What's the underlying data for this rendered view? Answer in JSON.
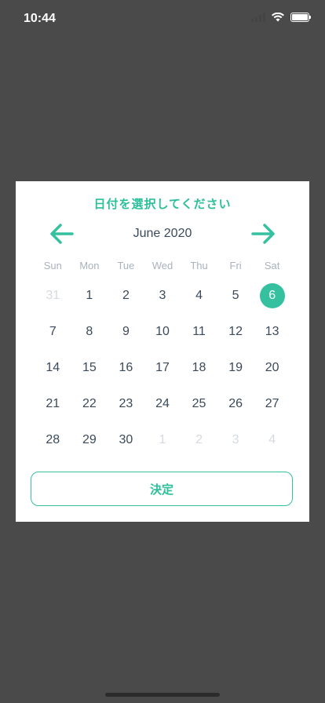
{
  "status_bar": {
    "time": "10:44"
  },
  "dialog": {
    "title": "日付を選択してください",
    "month_label": "June 2020",
    "weekdays": [
      "Sun",
      "Mon",
      "Tue",
      "Wed",
      "Thu",
      "Fri",
      "Sat"
    ],
    "days": [
      {
        "label": "31",
        "muted": true
      },
      {
        "label": "1"
      },
      {
        "label": "2"
      },
      {
        "label": "3"
      },
      {
        "label": "4"
      },
      {
        "label": "5"
      },
      {
        "label": "6",
        "selected": true
      },
      {
        "label": "7"
      },
      {
        "label": "8"
      },
      {
        "label": "9"
      },
      {
        "label": "10"
      },
      {
        "label": "11"
      },
      {
        "label": "12"
      },
      {
        "label": "13"
      },
      {
        "label": "14"
      },
      {
        "label": "15"
      },
      {
        "label": "16"
      },
      {
        "label": "17"
      },
      {
        "label": "18"
      },
      {
        "label": "19"
      },
      {
        "label": "20"
      },
      {
        "label": "21"
      },
      {
        "label": "22"
      },
      {
        "label": "23"
      },
      {
        "label": "24"
      },
      {
        "label": "25"
      },
      {
        "label": "26"
      },
      {
        "label": "27"
      },
      {
        "label": "28"
      },
      {
        "label": "29"
      },
      {
        "label": "30"
      },
      {
        "label": "1",
        "muted": true
      },
      {
        "label": "2",
        "muted": true
      },
      {
        "label": "3",
        "muted": true
      },
      {
        "label": "4",
        "muted": true
      }
    ],
    "confirm_label": "決定",
    "icons": {
      "prev": "arrow-left-icon",
      "next": "arrow-right-icon"
    }
  },
  "colors": {
    "accent": "#35c1a0",
    "text": "#3b4a5a",
    "muted": "#d4dadf",
    "overlay": "#4a4a4a"
  }
}
